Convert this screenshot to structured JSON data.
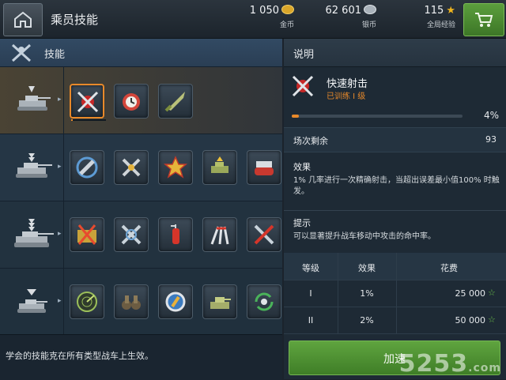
{
  "header": {
    "title": "乘员技能",
    "gold": {
      "value": "1 050",
      "label": "金币"
    },
    "silver": {
      "value": "62 601",
      "label": "银币"
    },
    "xp": {
      "value": "115",
      "label": "全局经验"
    }
  },
  "left": {
    "header_label": "技能",
    "footer_note": "学会的技能克在所有类型战车上生效。"
  },
  "tiers": [
    {
      "skills": [
        "rapid-fire-icon",
        "alarm-clock-icon",
        "shell-icon"
      ]
    },
    {
      "skills": [
        "spinning-shell-icon",
        "crossed-shells-icon",
        "star-badge-icon",
        "tank-up-icon",
        "tread-icon"
      ]
    },
    {
      "skills": [
        "ammo-box-icon",
        "crossed-wrench-icon",
        "fire-extinguisher-icon",
        "claw-icon",
        "repair-tools-icon"
      ]
    },
    {
      "skills": [
        "radar-icon",
        "binoculars-icon",
        "no-symbol-icon",
        "tank-armor-icon",
        "refresh-arrows-icon"
      ]
    }
  ],
  "details": {
    "header_label": "说明",
    "skill_name": "快速射击",
    "skill_status": "已训练 I 级",
    "progress_percent": 4,
    "progress_label": "4%",
    "battles_label": "场次剩余",
    "battles_value": "93",
    "effect_title": "效果",
    "effect_text": "1% 几率进行一次精确射击，当超出误差最小值100% 时触发。",
    "tip_title": "提示",
    "tip_text": "可以显著提升战车移动中攻击的命中率。",
    "table": {
      "headers": [
        "等级",
        "效果",
        "花费"
      ],
      "rows": [
        {
          "level": "I",
          "effect": "1%",
          "cost": "25 000"
        },
        {
          "level": "II",
          "effect": "2%",
          "cost": "50 000"
        }
      ]
    },
    "speed_button": "加速"
  },
  "watermark": {
    "main": "5253",
    "suffix": ".com"
  },
  "colors": {
    "accent": "#e8892a",
    "green": "#5fa43f",
    "gold": "#f0b51e"
  }
}
